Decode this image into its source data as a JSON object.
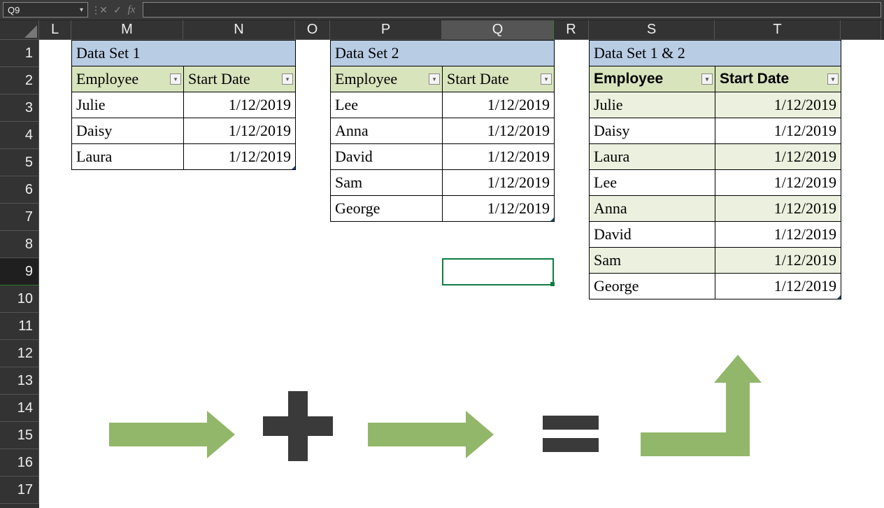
{
  "namebox": "Q9",
  "columns": [
    "L",
    "M",
    "N",
    "O",
    "P",
    "Q",
    "R",
    "S",
    "T",
    ""
  ],
  "rows": [
    "1",
    "2",
    "3",
    "4",
    "5",
    "6",
    "7",
    "8",
    "9",
    "10",
    "11",
    "12",
    "13",
    "14",
    "15",
    "16",
    "17"
  ],
  "active_col": "Q",
  "active_row": "9",
  "colwidths": {
    "L": 46,
    "M": 160,
    "N": 160,
    "O": 50,
    "P": 160,
    "Q": 160,
    "R": 50,
    "S": 180,
    "T": 180,
    "rest": 58
  },
  "table1": {
    "title": "Data Set 1",
    "headers": [
      "Employee",
      "Start Date"
    ],
    "rows": [
      {
        "emp": "Julie",
        "date": "1/12/2019"
      },
      {
        "emp": "Daisy",
        "date": "1/12/2019"
      },
      {
        "emp": "Laura",
        "date": "1/12/2019"
      }
    ]
  },
  "table2": {
    "title": "Data Set 2",
    "headers": [
      "Employee",
      "Start Date"
    ],
    "rows": [
      {
        "emp": "Lee",
        "date": "1/12/2019"
      },
      {
        "emp": "Anna",
        "date": "1/12/2019"
      },
      {
        "emp": "David",
        "date": "1/12/2019"
      },
      {
        "emp": "Sam",
        "date": "1/12/2019"
      },
      {
        "emp": "George",
        "date": "1/12/2019"
      }
    ]
  },
  "table3": {
    "title": "Data Set 1 & 2",
    "headers": [
      "Employee",
      "Start Date"
    ],
    "rows": [
      {
        "emp": "Julie",
        "date": "1/12/2019",
        "band": true
      },
      {
        "emp": "Daisy",
        "date": "1/12/2019",
        "band": false
      },
      {
        "emp": "Laura",
        "date": "1/12/2019",
        "band": true
      },
      {
        "emp": "Lee",
        "date": "1/12/2019",
        "band": false
      },
      {
        "emp": "Anna",
        "date": "1/12/2019",
        "band": true
      },
      {
        "emp": "David",
        "date": "1/12/2019",
        "band": false
      },
      {
        "emp": "Sam",
        "date": "1/12/2019",
        "band": true
      },
      {
        "emp": "George",
        "date": "1/12/2019",
        "band": false
      }
    ]
  }
}
